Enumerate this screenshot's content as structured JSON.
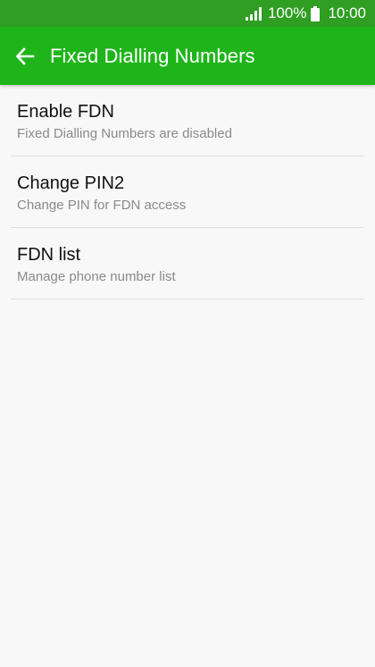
{
  "status_bar": {
    "battery_percent": "100%",
    "time": "10:00",
    "signal_icon": "signal-icon",
    "battery_icon": "battery-icon"
  },
  "app_bar": {
    "title": "Fixed Dialling Numbers",
    "back_icon": "back-arrow-icon",
    "color": "#1fb51a"
  },
  "items": [
    {
      "title": "Enable FDN",
      "subtitle": "Fixed Dialling Numbers are disabled"
    },
    {
      "title": "Change PIN2",
      "subtitle": "Change PIN for FDN access"
    },
    {
      "title": "FDN list",
      "subtitle": "Manage phone number list"
    }
  ]
}
